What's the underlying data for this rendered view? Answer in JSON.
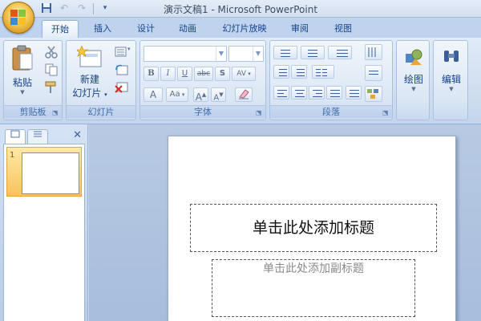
{
  "window": {
    "title": "演示文稿1 - Microsoft PowerPoint"
  },
  "quick_access": {
    "icons": [
      "save-icon",
      "undo-icon",
      "redo-icon",
      "customize-qat-icon"
    ]
  },
  "tabs": [
    {
      "label": "开始",
      "active": true
    },
    {
      "label": "插入",
      "active": false
    },
    {
      "label": "设计",
      "active": false
    },
    {
      "label": "动画",
      "active": false
    },
    {
      "label": "幻灯片放映",
      "active": false
    },
    {
      "label": "审阅",
      "active": false
    },
    {
      "label": "视图",
      "active": false
    }
  ],
  "ribbon": {
    "clipboard": {
      "group_label": "剪贴板",
      "paste_label": "粘贴"
    },
    "slides": {
      "group_label": "幻灯片",
      "new_slide_label_line1": "新建",
      "new_slide_label_line2": "幻灯片"
    },
    "font": {
      "group_label": "字体",
      "font_name_value": "",
      "font_size_value": "",
      "bold": "B",
      "italic": "I",
      "underline": "U",
      "strikethrough": "abc",
      "shadow": "S",
      "spacing": "AV",
      "case": "Aa",
      "grow": "A",
      "shrink": "A",
      "color": "A"
    },
    "paragraph": {
      "group_label": "段落"
    },
    "drawing": {
      "label": "绘图"
    },
    "editing": {
      "label": "编辑"
    }
  },
  "slides_panel": {
    "slide_number": "1"
  },
  "slide": {
    "title_placeholder": "单击此处添加标题",
    "subtitle_placeholder": "单击此处添加副标题"
  },
  "colors": {
    "ribbon_blue": "#15428b",
    "selection_orange": "#f9c35b",
    "office_button": "#f3c64d"
  }
}
